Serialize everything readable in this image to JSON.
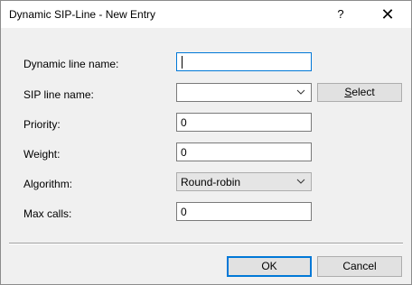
{
  "window": {
    "title": "Dynamic SIP-Line - New Entry",
    "help_glyph": "?",
    "close_glyph": "✕"
  },
  "form": {
    "dynamic_line_name": {
      "label": "Dynamic line name:",
      "value": ""
    },
    "sip_line_name": {
      "label": "SIP line name:",
      "value": ""
    },
    "select_button": {
      "mnemonic": "S",
      "rest": "elect"
    },
    "priority": {
      "label": "Priority:",
      "value": "0"
    },
    "weight": {
      "label": "Weight:",
      "value": "0"
    },
    "algorithm": {
      "label": "Algorithm:",
      "value": "Round-robin"
    },
    "max_calls": {
      "label": "Max calls:",
      "value": "0"
    }
  },
  "buttons": {
    "ok": "OK",
    "cancel": "Cancel"
  },
  "colors": {
    "focus_border": "#0078d7",
    "dialog_bg": "#f0f0f0"
  }
}
